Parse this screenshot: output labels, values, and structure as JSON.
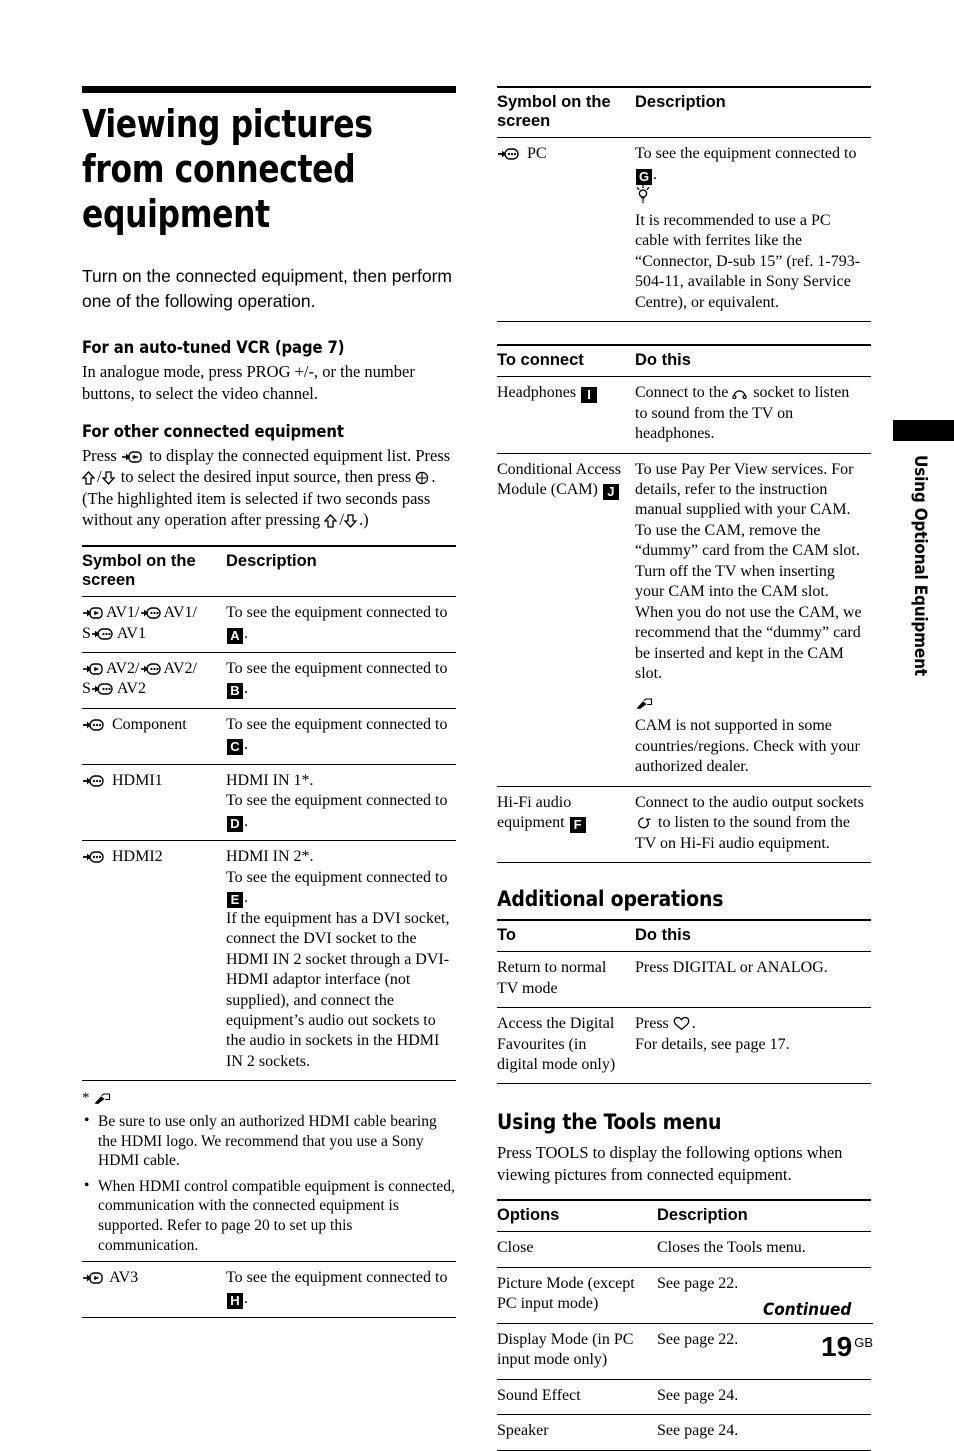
{
  "page": {
    "number": "19",
    "region_code": "GB",
    "continued_label": "Continued",
    "side_tab_label": "Using Optional Equipment"
  },
  "left": {
    "title": "Viewing pictures from connected equipment",
    "intro": "Turn on the connected equipment, then perform one of the following operation.",
    "sub1_heading": "For an auto-tuned VCR (page 7)",
    "sub1_body": "In analogue mode, press PROG +/-, or the number buttons, to select the video channel.",
    "sub2_heading": "For other connected equipment",
    "sub2_body_a": "Press ",
    "sub2_body_b": " to display the connected equipment list. Press ",
    "sub2_body_c": " to select the desired input source, then press ",
    "sub2_body_d": ". (The highlighted item is selected if two seconds pass without any operation after pressing ",
    "sub2_body_e": ".)",
    "table": {
      "headers": [
        "Symbol on the screen",
        "Description"
      ],
      "rows": [
        {
          "symbol_text": "AV1/",
          "symbol_text2": "AV1/",
          "symbol_text3": "AV1",
          "desc_pre": "To see the equipment connected to ",
          "badge": "A",
          "desc_post": "."
        },
        {
          "symbol_text": "AV2/",
          "symbol_text2": "AV2/",
          "symbol_text3": "AV2",
          "desc_pre": "To see the equipment connected to ",
          "badge": "B",
          "desc_post": "."
        },
        {
          "symbol_text": "Component",
          "desc_pre": "To see the equipment connected to ",
          "badge": "C",
          "desc_post": "."
        },
        {
          "symbol_text": "HDMI1",
          "desc_line1": "HDMI IN 1*.",
          "desc_pre": "To see the equipment connected to ",
          "badge": "D",
          "desc_post": "."
        },
        {
          "symbol_text": "HDMI2",
          "desc_line1": "HDMI IN 2*.",
          "desc_pre": "To see the equipment connected to ",
          "badge": "E",
          "desc_post": ".",
          "desc_extra": "If the equipment has a DVI socket, connect the DVI socket to the HDMI IN 2 socket through a DVI-HDMI adaptor interface (not supplied), and connect the equipment’s audio out sockets to the audio in sockets in the HDMI IN 2 sockets."
        }
      ],
      "footnote_marker": "*",
      "footnote_bullets": [
        "Be sure to use only an authorized HDMI cable bearing the HDMI logo. We recommend that you use a Sony HDMI cable.",
        "When HDMI control compatible equipment is connected, communication with the connected equipment is supported. Refer to page 20 to set up this communication."
      ],
      "last_row": {
        "symbol_text": "AV3",
        "desc_pre": "To see the equipment connected to ",
        "badge": "H",
        "desc_post": "."
      }
    }
  },
  "right": {
    "table_symbol": {
      "headers": [
        "Symbol on the screen",
        "Description"
      ],
      "rows": [
        {
          "symbol_text": "PC",
          "desc_pre": "To see the equipment connected to ",
          "badge": "G",
          "desc_post": ".",
          "tip_text": "It is recommended to use a PC cable with ferrites like the “Connector, D-sub 15” (ref. 1-793-504-11, available in Sony Service Centre), or equivalent."
        }
      ]
    },
    "table_connect": {
      "headers": [
        "To connect",
        "Do this"
      ],
      "rows": [
        {
          "label_pre": "Headphones ",
          "badge": "I",
          "do_pre": "Connect to the ",
          "do_post": " socket to listen to sound from the TV on headphones."
        },
        {
          "label_pre": "Conditional Access Module (CAM) ",
          "badge": "J",
          "do_text": "To use Pay Per View services. For details, refer to the instruction manual supplied with your CAM. To use the CAM, remove the “dummy” card from the CAM slot. Turn off the TV when inserting your CAM into the CAM slot. When you do not use the CAM, we recommend that the “dummy” card be inserted and kept in the CAM slot.",
          "note_text": "CAM is not supported in some countries/regions. Check with your authorized dealer."
        },
        {
          "label_pre": "Hi-Fi audio equipment ",
          "badge": "F",
          "do_pre": "Connect to the audio output sockets ",
          "do_post": " to listen to the sound from the TV on Hi-Fi audio equipment."
        }
      ]
    },
    "additional_heading": "Additional operations",
    "table_additional": {
      "headers": [
        "To",
        "Do this"
      ],
      "rows": [
        {
          "to": "Return to normal TV mode",
          "do": "Press DIGITAL or ANALOG."
        },
        {
          "to": "Access the Digital Favourites (in digital mode only)",
          "do_pre": "Press ",
          "do_post": ".",
          "do_line2": "For details, see page 17."
        }
      ]
    },
    "tools_heading": "Using the Tools menu",
    "tools_body": "Press TOOLS to display the following options when viewing pictures from connected equipment.",
    "table_tools": {
      "headers": [
        "Options",
        "Description"
      ],
      "rows": [
        {
          "option": "Close",
          "description": "Closes the Tools menu."
        },
        {
          "option": "Picture Mode (except PC input mode)",
          "description": "See page 22."
        },
        {
          "option": "Display Mode (in PC input mode only)",
          "description": "See page 22."
        },
        {
          "option": "Sound Effect",
          "description": "See page 24."
        },
        {
          "option": "Speaker",
          "description": "See page 24."
        }
      ]
    }
  },
  "icons": {
    "input_arrow": "input-arrow-icon",
    "component": "component-socket-icon",
    "s_video": "s-video-icon",
    "up_arrow": "up-arrow-icon",
    "down_arrow": "down-arrow-icon",
    "enter": "enter-circle-icon",
    "note": "note-pencil-icon",
    "tip": "tip-bulb-icon",
    "headphone": "headphone-socket-icon",
    "audio_out": "audio-output-icon",
    "heart": "heart-favourites-icon"
  }
}
